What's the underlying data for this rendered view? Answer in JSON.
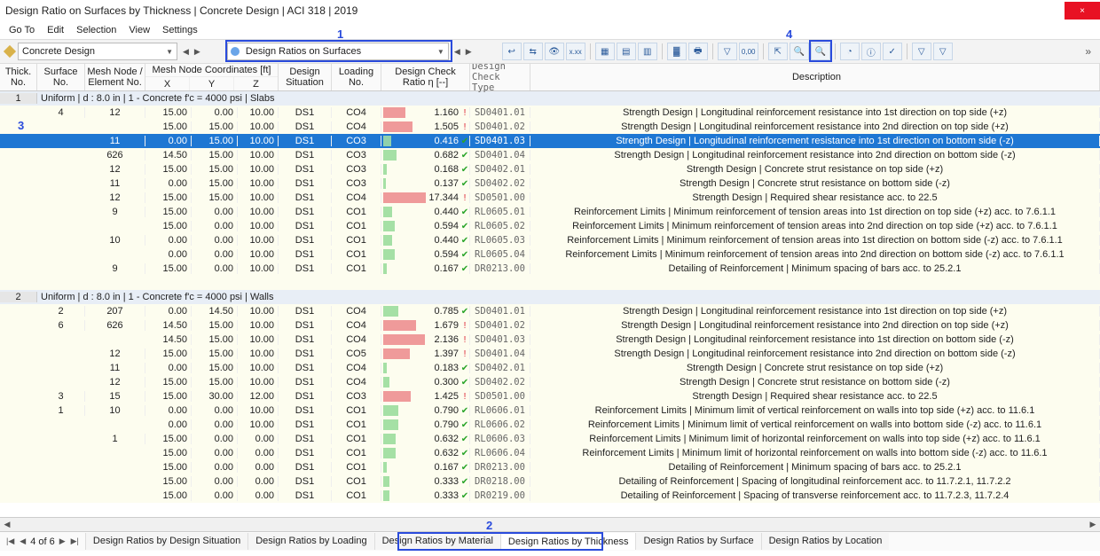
{
  "window": {
    "title": "Design Ratio on Surfaces by Thickness | Concrete Design | ACI 318 | 2019",
    "close": "×"
  },
  "menu": [
    "Go To",
    "Edit",
    "Selection",
    "View",
    "Settings"
  ],
  "toolbar": {
    "combo1": "Concrete Design",
    "combo2": "Design Ratios on Surfaces"
  },
  "annotations": {
    "a1": "1",
    "a2": "2",
    "a3": "3",
    "a4": "4"
  },
  "headers": {
    "thick": "Thick.\nNo.",
    "surface": "Surface\nNo.",
    "mesh": "Mesh Node /\nElement No.",
    "coords_top": "Mesh Node Coordinates [ft]",
    "x": "X",
    "y": "Y",
    "z": "Z",
    "ds": "Design\nSituation",
    "load": "Loading\nNo.",
    "ratio": "Design Check\nRatio η [--]",
    "type": "Design Check\nType",
    "desc": "Description"
  },
  "groups": [
    {
      "thick": "1",
      "label": "Uniform | d : 8.0 in | 1 - Concrete f'c = 4000 psi | Slabs",
      "rows": [
        {
          "surf": "4",
          "mesh": "12",
          "x": "15.00",
          "y": "0.00",
          "z": "10.00",
          "ds": "DS1",
          "load": "CO4",
          "ratio": 1.16,
          "bad": true,
          "type": "SD0401.01",
          "desc": "Strength Design | Longitudinal reinforcement resistance into 1st direction on top side (+z)"
        },
        {
          "surf": "",
          "mesh": "",
          "x": "15.00",
          "y": "15.00",
          "z": "10.00",
          "ds": "DS1",
          "load": "CO4",
          "ratio": 1.505,
          "bad": true,
          "type": "SD0401.02",
          "desc": "Strength Design | Longitudinal reinforcement resistance into 2nd direction on top side (+z)"
        },
        {
          "sel": true,
          "surf": "",
          "mesh": "11",
          "x": "0.00",
          "y": "15.00",
          "z": "10.00",
          "ds": "DS1",
          "load": "CO3",
          "ratio": 0.416,
          "bad": false,
          "type": "SD0401.03",
          "desc": "Strength Design | Longitudinal reinforcement resistance into 1st direction on bottom side (-z)"
        },
        {
          "surf": "",
          "mesh": "626",
          "x": "14.50",
          "y": "15.00",
          "z": "10.00",
          "ds": "DS1",
          "load": "CO3",
          "ratio": 0.682,
          "bad": false,
          "type": "SD0401.04",
          "desc": "Strength Design | Longitudinal reinforcement resistance into 2nd direction on bottom side (-z)"
        },
        {
          "surf": "",
          "mesh": "12",
          "x": "15.00",
          "y": "15.00",
          "z": "10.00",
          "ds": "DS1",
          "load": "CO3",
          "ratio": 0.168,
          "bad": false,
          "type": "SD0402.01",
          "desc": "Strength Design | Concrete strut resistance on top side (+z)"
        },
        {
          "surf": "",
          "mesh": "11",
          "x": "0.00",
          "y": "15.00",
          "z": "10.00",
          "ds": "DS1",
          "load": "CO3",
          "ratio": 0.137,
          "bad": false,
          "type": "SD0402.02",
          "desc": "Strength Design | Concrete strut resistance on bottom side (-z)"
        },
        {
          "surf": "",
          "mesh": "12",
          "x": "15.00",
          "y": "15.00",
          "z": "10.00",
          "ds": "DS1",
          "load": "CO4",
          "ratio": 17.344,
          "bad": true,
          "type": "SD0501.00",
          "desc": "Strength Design | Required shear resistance acc. to 22.5"
        },
        {
          "surf": "",
          "mesh": "9",
          "x": "15.00",
          "y": "0.00",
          "z": "10.00",
          "ds": "DS1",
          "load": "CO1",
          "ratio": 0.44,
          "bad": false,
          "type": "RL0605.01",
          "desc": "Reinforcement Limits | Minimum reinforcement of tension areas into 1st direction on top side (+z) acc. to 7.6.1.1"
        },
        {
          "surf": "",
          "mesh": "",
          "x": "15.00",
          "y": "0.00",
          "z": "10.00",
          "ds": "DS1",
          "load": "CO1",
          "ratio": 0.594,
          "bad": false,
          "type": "RL0605.02",
          "desc": "Reinforcement Limits | Minimum reinforcement of tension areas into 2nd direction on top side (+z) acc. to 7.6.1.1"
        },
        {
          "surf": "",
          "mesh": "10",
          "x": "0.00",
          "y": "0.00",
          "z": "10.00",
          "ds": "DS1",
          "load": "CO1",
          "ratio": 0.44,
          "bad": false,
          "type": "RL0605.03",
          "desc": "Reinforcement Limits | Minimum reinforcement of tension areas into 1st direction on bottom side (-z) acc. to 7.6.1.1"
        },
        {
          "surf": "",
          "mesh": "",
          "x": "0.00",
          "y": "0.00",
          "z": "10.00",
          "ds": "DS1",
          "load": "CO1",
          "ratio": 0.594,
          "bad": false,
          "type": "RL0605.04",
          "desc": "Reinforcement Limits | Minimum reinforcement of tension areas into 2nd direction on bottom side (-z) acc. to 7.6.1.1"
        },
        {
          "surf": "",
          "mesh": "9",
          "x": "15.00",
          "y": "0.00",
          "z": "10.00",
          "ds": "DS1",
          "load": "CO1",
          "ratio": 0.167,
          "bad": false,
          "type": "DR0213.00",
          "desc": "Detailing of Reinforcement | Minimum spacing of bars acc. to 25.2.1"
        }
      ]
    },
    {
      "thick": "2",
      "label": "Uniform | d : 8.0 in | 1 - Concrete f'c = 4000 psi | Walls",
      "rows": [
        {
          "surf": "2",
          "mesh": "207",
          "x": "0.00",
          "y": "14.50",
          "z": "10.00",
          "ds": "DS1",
          "load": "CO4",
          "ratio": 0.785,
          "bad": false,
          "type": "SD0401.01",
          "desc": "Strength Design | Longitudinal reinforcement resistance into 1st direction on top side (+z)"
        },
        {
          "surf": "6",
          "mesh": "626",
          "x": "14.50",
          "y": "15.00",
          "z": "10.00",
          "ds": "DS1",
          "load": "CO4",
          "ratio": 1.679,
          "bad": true,
          "type": "SD0401.02",
          "desc": "Strength Design | Longitudinal reinforcement resistance into 2nd direction on top side (+z)"
        },
        {
          "surf": "",
          "mesh": "",
          "x": "14.50",
          "y": "15.00",
          "z": "10.00",
          "ds": "DS1",
          "load": "CO4",
          "ratio": 2.136,
          "bad": true,
          "type": "SD0401.03",
          "desc": "Strength Design | Longitudinal reinforcement resistance into 1st direction on bottom side (-z)"
        },
        {
          "surf": "",
          "mesh": "12",
          "x": "15.00",
          "y": "15.00",
          "z": "10.00",
          "ds": "DS1",
          "load": "CO5",
          "ratio": 1.397,
          "bad": true,
          "type": "SD0401.04",
          "desc": "Strength Design | Longitudinal reinforcement resistance into 2nd direction on bottom side (-z)"
        },
        {
          "surf": "",
          "mesh": "11",
          "x": "0.00",
          "y": "15.00",
          "z": "10.00",
          "ds": "DS1",
          "load": "CO4",
          "ratio": 0.183,
          "bad": false,
          "type": "SD0402.01",
          "desc": "Strength Design | Concrete strut resistance on top side (+z)"
        },
        {
          "surf": "",
          "mesh": "12",
          "x": "15.00",
          "y": "15.00",
          "z": "10.00",
          "ds": "DS1",
          "load": "CO4",
          "ratio": 0.3,
          "bad": false,
          "type": "SD0402.02",
          "desc": "Strength Design | Concrete strut resistance on bottom side (-z)"
        },
        {
          "surf": "3",
          "mesh": "15",
          "x": "15.00",
          "y": "30.00",
          "z": "12.00",
          "ds": "DS1",
          "load": "CO3",
          "ratio": 1.425,
          "bad": true,
          "type": "SD0501.00",
          "desc": "Strength Design | Required shear resistance acc. to 22.5"
        },
        {
          "surf": "1",
          "mesh": "10",
          "x": "0.00",
          "y": "0.00",
          "z": "10.00",
          "ds": "DS1",
          "load": "CO1",
          "ratio": 0.79,
          "bad": false,
          "type": "RL0606.01",
          "desc": "Reinforcement Limits | Minimum limit of vertical reinforcement on walls into top side (+z) acc. to 11.6.1"
        },
        {
          "surf": "",
          "mesh": "",
          "x": "0.00",
          "y": "0.00",
          "z": "10.00",
          "ds": "DS1",
          "load": "CO1",
          "ratio": 0.79,
          "bad": false,
          "type": "RL0606.02",
          "desc": "Reinforcement Limits | Minimum limit of vertical reinforcement on walls into bottom side (-z) acc. to 11.6.1"
        },
        {
          "surf": "",
          "mesh": "1",
          "x": "15.00",
          "y": "0.00",
          "z": "0.00",
          "ds": "DS1",
          "load": "CO1",
          "ratio": 0.632,
          "bad": false,
          "type": "RL0606.03",
          "desc": "Reinforcement Limits | Minimum limit of horizontal reinforcement on walls into top side (+z) acc. to 11.6.1"
        },
        {
          "surf": "",
          "mesh": "",
          "x": "15.00",
          "y": "0.00",
          "z": "0.00",
          "ds": "DS1",
          "load": "CO1",
          "ratio": 0.632,
          "bad": false,
          "type": "RL0606.04",
          "desc": "Reinforcement Limits | Minimum limit of horizontal reinforcement on walls into bottom side (-z) acc. to 11.6.1"
        },
        {
          "surf": "",
          "mesh": "",
          "x": "15.00",
          "y": "0.00",
          "z": "0.00",
          "ds": "DS1",
          "load": "CO1",
          "ratio": 0.167,
          "bad": false,
          "type": "DR0213.00",
          "desc": "Detailing of Reinforcement | Minimum spacing of bars acc. to 25.2.1"
        },
        {
          "surf": "",
          "mesh": "",
          "x": "15.00",
          "y": "0.00",
          "z": "0.00",
          "ds": "DS1",
          "load": "CO1",
          "ratio": 0.333,
          "bad": false,
          "type": "DR0218.00",
          "desc": "Detailing of Reinforcement | Spacing of longitudinal reinforcement acc. to 11.7.2.1, 11.7.2.2"
        },
        {
          "surf": "",
          "mesh": "",
          "x": "15.00",
          "y": "0.00",
          "z": "0.00",
          "ds": "DS1",
          "load": "CO1",
          "ratio": 0.333,
          "bad": false,
          "type": "DR0219.00",
          "desc": "Detailing of Reinforcement | Spacing of transverse reinforcement acc. to 11.7.2.3, 11.7.2.4"
        }
      ]
    }
  ],
  "pager": {
    "text": "4 of 6"
  },
  "tabs": [
    "Design Ratios by Design Situation",
    "Design Ratios by Loading",
    "Design Ratios by Material",
    "Design Ratios by Thickness",
    "Design Ratios by Surface",
    "Design Ratios by Location"
  ],
  "active_tab": 3
}
